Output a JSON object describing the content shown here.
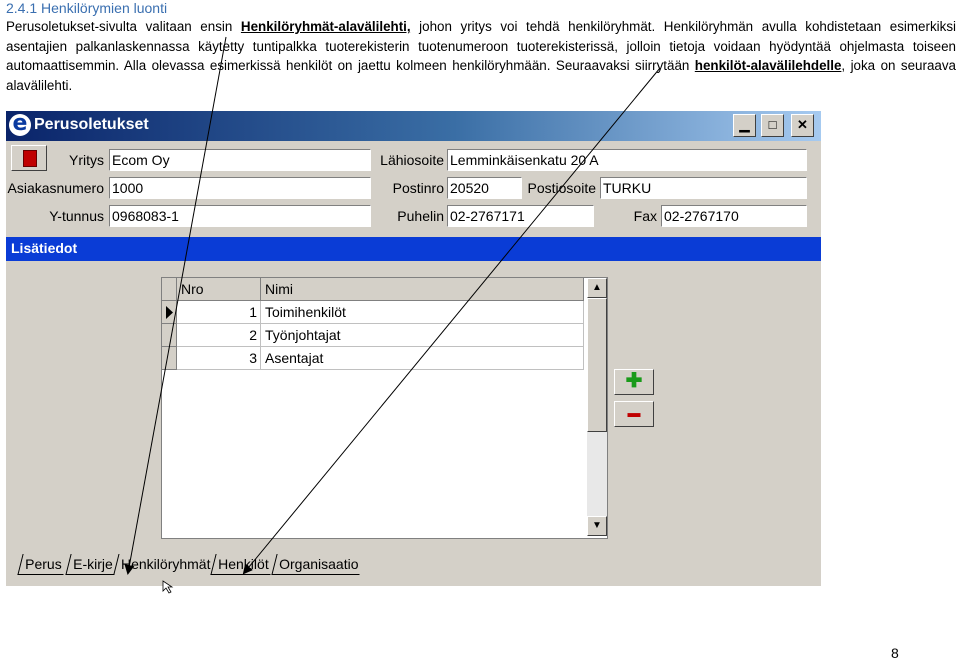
{
  "doc": {
    "heading": "2.4.1 Henkilörymien luonti",
    "para_part1": "Perusoletukset-sivulta valitaan ensin ",
    "para_link1": "Henkilöryhmät-alavälilehti,",
    "para_part2": " johon yritys voi tehdä henkilöryhmät. Henkilöryhmän avulla kohdistetaan esimerkiksi asentajien palkanlaskennassa käytetty tuntipalkka tuoterekisterin tuotenumeroon tuoterekisterissä, jolloin tietoja voidaan hyödyntää ohjelmasta toiseen automaattisemmin. Alla olevassa esimerkissä henkilöt on jaettu kolmeen henkilöryhmään. Seuraavaksi siirrytään ",
    "para_link2": "henkilöt-alavälilehdelle",
    "para_part3": ", joka on seuraava alavälilehti.",
    "page_number": "8"
  },
  "window": {
    "app_icon": "app-e-icon",
    "title": "Perusoletukset",
    "minimize_glyph": "▁",
    "maximize_glyph": "□",
    "close_glyph": "✕"
  },
  "form": {
    "yritys_label": "Yritys",
    "yritys_value": "Ecom Oy",
    "asiakasnumero_label": "Asiakasnumero",
    "asiakasnumero_value": "1000",
    "ytunnus_label": "Y-tunnus",
    "ytunnus_value": "0968083-1",
    "lahiosoite_label": "Lähiosoite",
    "lahiosoite_value": "Lemminkäisenkatu 20 A",
    "postinro_label": "Postinro",
    "postinro_value": "20520",
    "postiosoite_label": "Postiosoite",
    "postiosoite_value": "TURKU",
    "puhelin_label": "Puhelin",
    "puhelin_value": "02-2767171",
    "fax_label": "Fax",
    "fax_value": "02-2767170"
  },
  "section": {
    "title": "Lisätiedot"
  },
  "grid": {
    "columns": [
      "Nro",
      "Nimi"
    ],
    "rows": [
      {
        "nro": "1",
        "nimi": "Toimihenkilöt"
      },
      {
        "nro": "2",
        "nimi": "Työnjohtajat"
      },
      {
        "nro": "3",
        "nimi": "Asentajat"
      }
    ]
  },
  "buttons": {
    "add_glyph": "✚",
    "remove_glyph": "▬"
  },
  "tabs": [
    "Perus",
    "E-kirje",
    "Henkilöryhmät",
    "Henkilöt",
    "Organisaatio"
  ],
  "colors": {
    "title_bar": "#0a246a",
    "section_bar": "#0a3cd6",
    "add": "#1a9a1a",
    "remove": "#c00000"
  }
}
